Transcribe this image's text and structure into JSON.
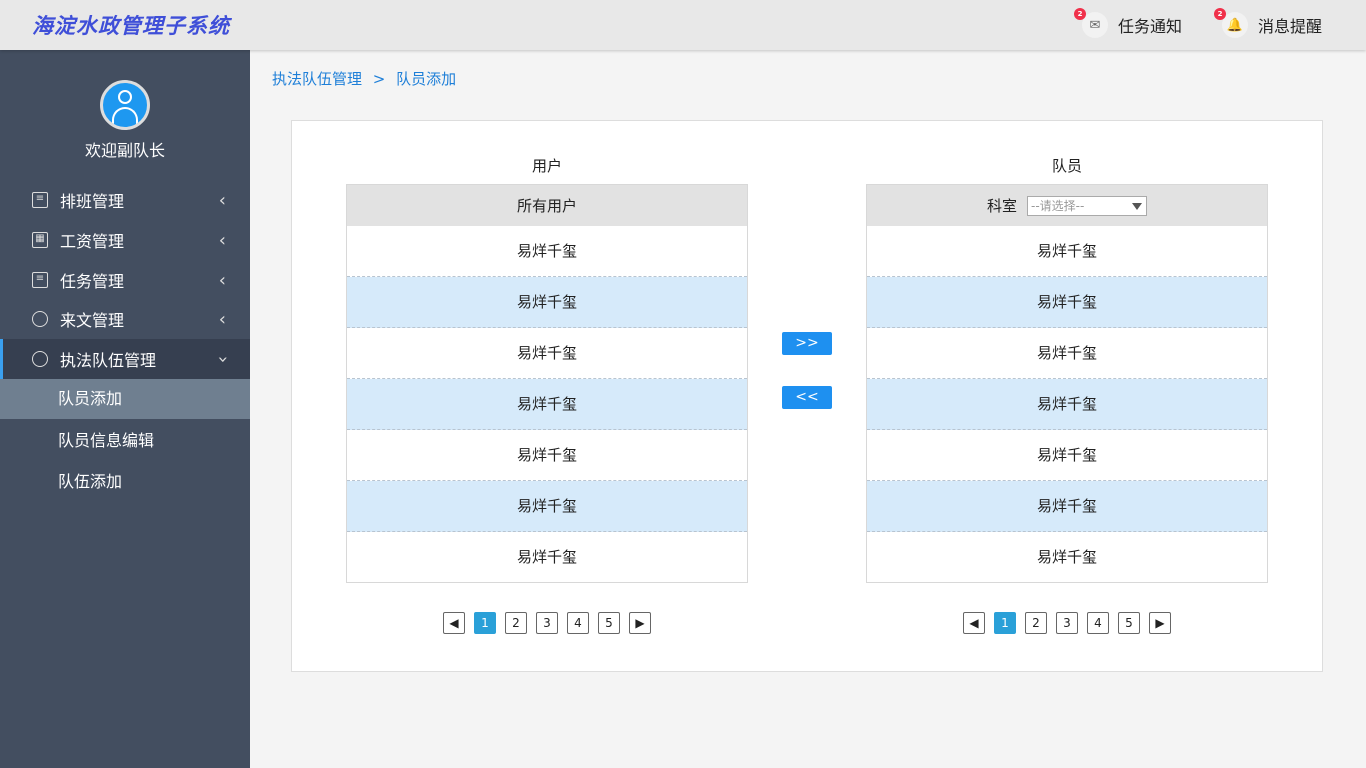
{
  "header": {
    "title": "海淀水政管理子系统",
    "task_label": "任务通知",
    "task_badge": "2",
    "msg_label": "消息提醒",
    "msg_badge": "2"
  },
  "sidebar": {
    "welcome": "欢迎副队长",
    "items": [
      {
        "label": "排班管理"
      },
      {
        "label": "工资管理"
      },
      {
        "label": "任务管理"
      },
      {
        "label": "来文管理"
      },
      {
        "label": "执法队伍管理"
      }
    ],
    "subitems": [
      {
        "label": "队员添加"
      },
      {
        "label": "队员信息编辑"
      },
      {
        "label": "队伍添加"
      }
    ]
  },
  "breadcrumb": {
    "parent": "执法队伍管理",
    "sep": ">",
    "current": "队员添加"
  },
  "left": {
    "title": "用户",
    "header": "所有用户",
    "rows": [
      "易烊千玺",
      "易烊千玺",
      "易烊千玺",
      "易烊千玺",
      "易烊千玺",
      "易烊千玺",
      "易烊千玺"
    ]
  },
  "right": {
    "title": "队员",
    "filter_label": "科室",
    "filter_placeholder": "--请选择--",
    "rows": [
      "易烊千玺",
      "易烊千玺",
      "易烊千玺",
      "易烊千玺",
      "易烊千玺",
      "易烊千玺",
      "易烊千玺"
    ]
  },
  "buttons": {
    "add": ">>",
    "remove": "<<"
  },
  "pager": {
    "pages": [
      "1",
      "2",
      "3",
      "4",
      "5"
    ],
    "current": "1"
  }
}
